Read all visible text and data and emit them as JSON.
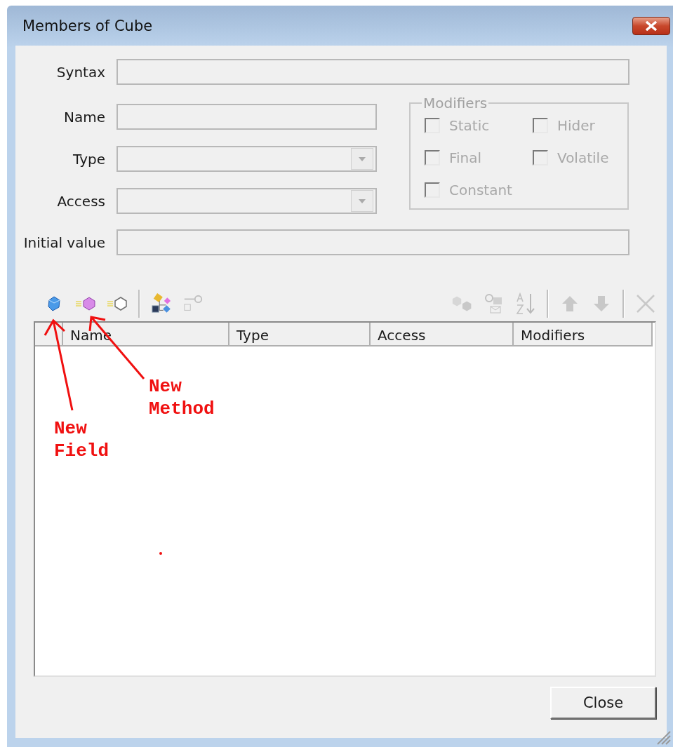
{
  "window": {
    "title": "Members of Cube"
  },
  "form": {
    "fields": [
      {
        "kind": "text",
        "label": "Syntax",
        "disabled": true,
        "wide": true
      },
      {
        "kind": "text",
        "label": "Name",
        "disabled": true,
        "wide": false
      },
      {
        "kind": "dropdown",
        "label": "Type",
        "disabled": true,
        "wide": false
      },
      {
        "kind": "dropdown",
        "label": "Access",
        "disabled": true,
        "wide": false
      },
      {
        "kind": "text",
        "label": "Initial value",
        "disabled": true,
        "wide": true
      }
    ]
  },
  "modifiers": {
    "title": "Modifiers",
    "checkboxes": [
      {
        "label": "Static",
        "checked": false,
        "disabled": true
      },
      {
        "label": "Hider",
        "checked": false,
        "disabled": true
      },
      {
        "label": "Final",
        "checked": false,
        "disabled": true
      },
      {
        "label": "Volatile",
        "checked": false,
        "disabled": true
      },
      {
        "label": "Constant",
        "checked": false,
        "disabled": true
      }
    ]
  },
  "toolbar": {
    "left": [
      {
        "kind": "field",
        "disabled": false
      },
      {
        "kind": "method",
        "disabled": false
      },
      {
        "kind": "property",
        "disabled": false
      },
      {
        "kind": "separator"
      },
      {
        "kind": "hierarchy",
        "disabled": false
      },
      {
        "kind": "link",
        "disabled": true
      }
    ],
    "right": [
      {
        "kind": "cubes",
        "disabled": true
      },
      {
        "kind": "locks",
        "disabled": true
      },
      {
        "kind": "sort",
        "disabled": true
      },
      {
        "kind": "separator"
      },
      {
        "kind": "up",
        "disabled": true
      },
      {
        "kind": "down",
        "disabled": true
      },
      {
        "kind": "separator"
      },
      {
        "kind": "delete",
        "disabled": true
      }
    ]
  },
  "table": {
    "columns": [
      "Name",
      "Type",
      "Access",
      "Modifiers"
    ]
  },
  "buttons": [
    "Close"
  ],
  "annotations": [
    {
      "text": "New\nField"
    },
    {
      "text": "New\nMethod"
    }
  ]
}
